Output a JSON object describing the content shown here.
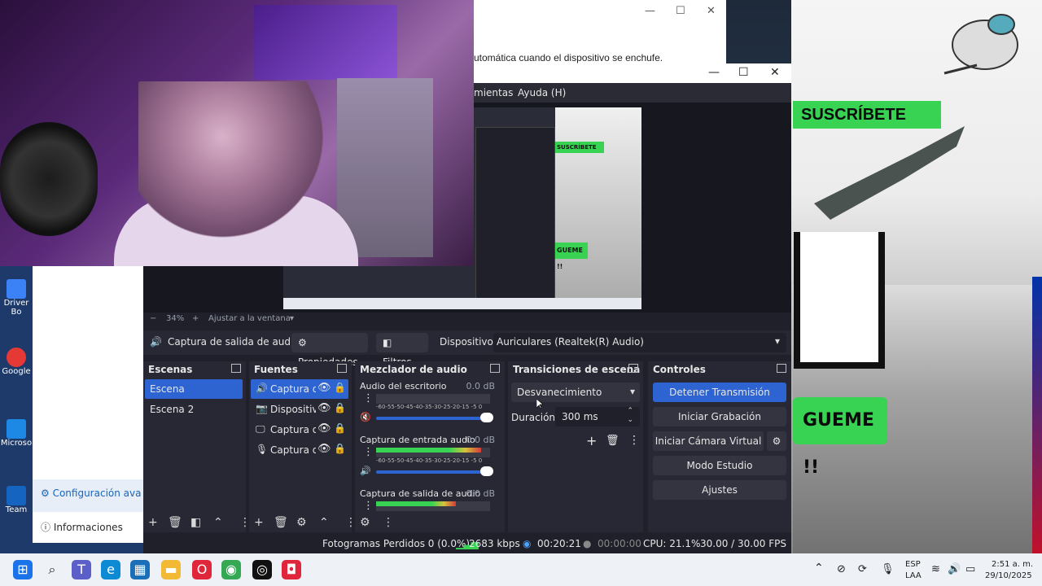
{
  "notepad": {
    "text": "utomática cuando el dispositivo se enchufe."
  },
  "obs": {
    "window_controls": [
      "—",
      "☐",
      "✕"
    ],
    "menu": [
      "mientas",
      "Ayuda (H)"
    ],
    "zoom": {
      "minus": "−",
      "level": "34%",
      "plus": "+",
      "fit": "Ajustar a la ventana"
    },
    "source_toolbar": {
      "source_name": "Captura de salida de audio",
      "properties": "Propiedades",
      "filters": "Filtros",
      "device_label": "Dispositivo",
      "device_value": "Auriculares (Realtek(R) Audio)"
    },
    "scenes": {
      "title": "Escenas",
      "items": [
        {
          "label": "Escena",
          "selected": true
        },
        {
          "label": "Escena 2",
          "selected": false
        }
      ]
    },
    "sources": {
      "title": "Fuentes",
      "items": [
        {
          "icon": "speaker-icon",
          "glyph": "🔊",
          "label": "Captura d",
          "selected": true
        },
        {
          "icon": "camera-icon",
          "glyph": "📷",
          "label": "Dispositiv",
          "selected": false
        },
        {
          "icon": "monitor-icon",
          "glyph": "🖵",
          "label": "Captura d",
          "selected": false
        },
        {
          "icon": "microphone-icon",
          "glyph": "🎙",
          "label": "Captura d",
          "selected": false
        }
      ]
    },
    "mixer": {
      "title": "Mezclador de audio",
      "scale": "-60-55-50-45-40-35-30-25-20-15 -5  0",
      "channels": [
        {
          "name": "Audio del escritorio",
          "db": "0.0 dB",
          "level": 0.0,
          "muted": true
        },
        {
          "name": "Captura de entrada audio",
          "db": "0.0 dB",
          "level": 0.92,
          "muted": false
        },
        {
          "name": "Captura de salida de audio",
          "db": "0.0 dB",
          "level": 0.7,
          "muted": false
        }
      ]
    },
    "transitions": {
      "title": "Transiciones de escena",
      "selected": "Desvanecimiento",
      "duration_label": "Duración",
      "duration_value": "300 ms"
    },
    "controls": {
      "title": "Controles",
      "buttons": [
        "Detener Transmisión",
        "Iniciar Grabación",
        "Iniciar Cámara Virtual",
        "Modo Estudio",
        "Ajustes"
      ]
    },
    "status": {
      "dropped": "Fotogramas Perdidos 0 (0.0%)",
      "bitrate": "2683 kbps",
      "stream_time": "00:20:21",
      "rec_time": "00:00:00",
      "cpu": "CPU: 21.1%",
      "fps": "30.00 / 30.00 FPS"
    }
  },
  "preview": {
    "subscribe": "SUSCRÍBETE",
    "sigueme": "GUEME !!"
  },
  "right_video": {
    "subscribe": "SUSCRÍBETE",
    "sigueme": "GUEME !!"
  },
  "desktop": {
    "icons": [
      "Driver Bo",
      "Google",
      "Microso",
      "Team"
    ],
    "flyout": {
      "item1": "Configuración ava",
      "item2": "Informaciones"
    }
  },
  "taskbar": {
    "lang1": "ESP",
    "lang2": "LAA",
    "time": "2:51 a. m.",
    "date": "29/10/2025"
  },
  "colors": {
    "accent": "#2e64d1",
    "green": "#39d353",
    "panel": "#272833",
    "bg": "#1f2029"
  }
}
